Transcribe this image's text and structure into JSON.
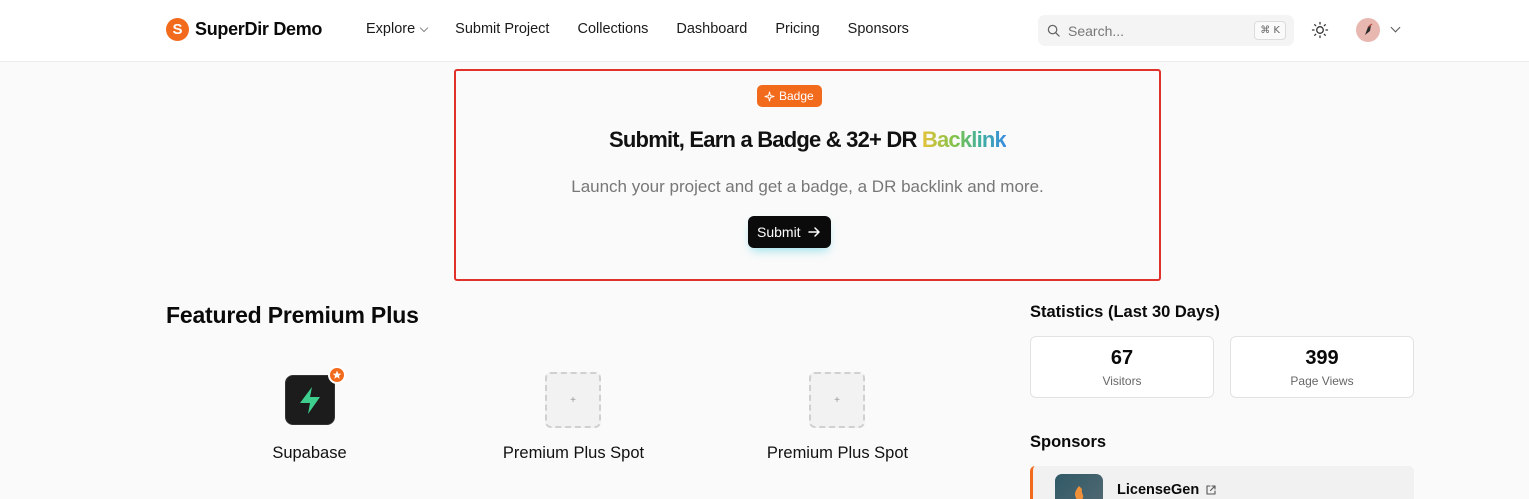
{
  "brand": {
    "logo_letter": "S",
    "name": "SuperDir Demo",
    "accent": "#f26b1d"
  },
  "nav": [
    {
      "label": "Explore",
      "has_dropdown": true
    },
    {
      "label": "Submit Project"
    },
    {
      "label": "Collections"
    },
    {
      "label": "Dashboard"
    },
    {
      "label": "Pricing"
    },
    {
      "label": "Sponsors"
    }
  ],
  "search": {
    "placeholder": "Search...",
    "shortcut": "⌘ K"
  },
  "hero": {
    "badge_label": "Badge",
    "title_main": "Submit, Earn a Badge & 32+ DR ",
    "title_highlight": "Backlink",
    "subtitle": "Launch your project and get a badge, a DR backlink and more.",
    "button_label": "Submit",
    "border_color": "#e0322a"
  },
  "featured": {
    "title": "Featured Premium Plus",
    "items": [
      {
        "label": "Supabase",
        "icon": "supabase-logo"
      },
      {
        "label": "Premium Plus Spot",
        "icon": "plus-icon",
        "icon_text": "+"
      },
      {
        "label": "Premium Plus Spot",
        "icon": "plus-icon",
        "icon_text": "+"
      }
    ]
  },
  "statistics": {
    "title": "Statistics (Last 30 Days)",
    "items": [
      {
        "value": "67",
        "label": "Visitors"
      },
      {
        "value": "399",
        "label": "Page Views"
      }
    ]
  },
  "sponsors": {
    "title": "Sponsors",
    "items": [
      {
        "name": "LicenseGen",
        "icon": "licensegen-logo"
      }
    ]
  }
}
